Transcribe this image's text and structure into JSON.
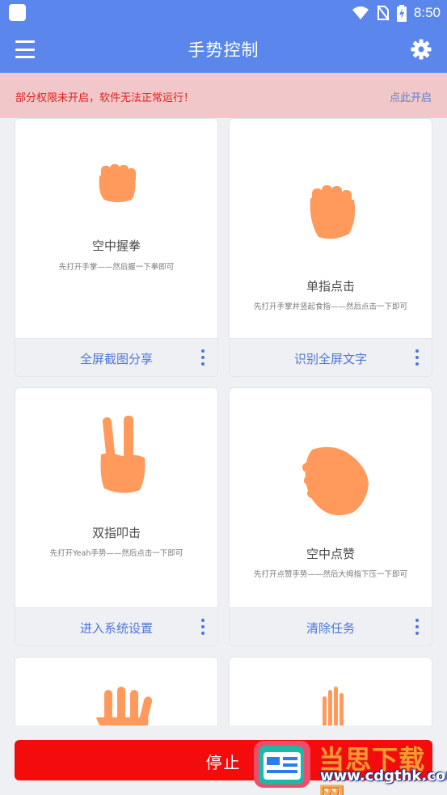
{
  "status_bar": {
    "time": "8:50"
  },
  "app_bar": {
    "title": "手势控制"
  },
  "warning": {
    "message": "部分权限未开启，软件无法正常运行！",
    "action": "点此开启"
  },
  "colors": {
    "primary": "#5b87ec",
    "hand": "#ff9a5c",
    "stop": "#f40b0b",
    "warning_bg": "#f2c7c9",
    "warning_text": "#e01f1f"
  },
  "gestures": [
    {
      "name": "空中握拳",
      "desc": "先打开手掌——然后握一下拳即可",
      "action": "全屏截图分享",
      "icon": "fist-icon"
    },
    {
      "name": "单指点击",
      "desc": "先打开手掌并竖起食指——然后点击一下即可",
      "action": "识别全屏文字",
      "icon": "fist-icon"
    },
    {
      "name": "双指叩击",
      "desc": "先打开Yeah手势——然后点击一下即可",
      "action": "进入系统设置",
      "icon": "peace-hand-icon"
    },
    {
      "name": "空中点赞",
      "desc": "先打开点赞手势——然后大拇指下压一下即可",
      "action": "清除任务",
      "icon": "thumbs-hand-icon"
    },
    {
      "icon": "open-hand-icon"
    },
    {
      "icon": "fingers-hand-icon"
    }
  ],
  "stop_button": {
    "label": "停止"
  },
  "watermark": {
    "brand": "当思下载网",
    "site": "www.cdgthk.com"
  }
}
